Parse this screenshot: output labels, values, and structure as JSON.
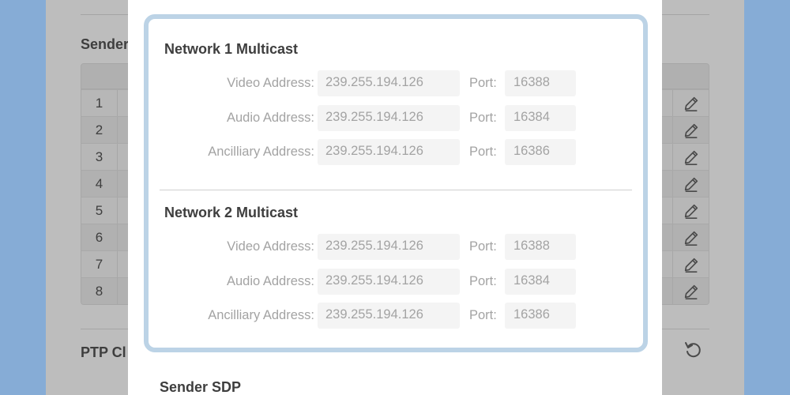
{
  "background": {
    "senders_heading": "Sender",
    "ptp_heading": "PTP Cl",
    "row_numbers": [
      "1",
      "2",
      "3",
      "4",
      "5",
      "6",
      "7",
      "8"
    ]
  },
  "modal": {
    "network1": {
      "title": "Network 1 Multicast",
      "rows": [
        {
          "label": "Video Address:",
          "address": "239.255.194.126",
          "port_label": "Port:",
          "port": "16388"
        },
        {
          "label": "Audio Address:",
          "address": "239.255.194.126",
          "port_label": "Port:",
          "port": "16384"
        },
        {
          "label": "Ancilliary Address:",
          "address": "239.255.194.126",
          "port_label": "Port:",
          "port": "16386"
        }
      ]
    },
    "network2": {
      "title": "Network 2 Multicast",
      "rows": [
        {
          "label": "Video Address:",
          "address": "239.255.194.126",
          "port_label": "Port:",
          "port": "16388"
        },
        {
          "label": "Audio Address:",
          "address": "239.255.194.126",
          "port_label": "Port:",
          "port": "16384"
        },
        {
          "label": "Ancilliary Address:",
          "address": "239.255.194.126",
          "port_label": "Port:",
          "port": "16386"
        }
      ]
    },
    "sdp_title": "Sender SDP"
  },
  "colors": {
    "frame": "#86acd6",
    "dim_background": "#bdbdbd",
    "modal_border": "#bcd3e6",
    "field_background": "#f4f4f4",
    "muted_text": "#a3a3a3",
    "heading_text": "#3e3e3e"
  },
  "icons": {
    "edit": "pencil-icon",
    "refresh": "refresh-icon"
  }
}
